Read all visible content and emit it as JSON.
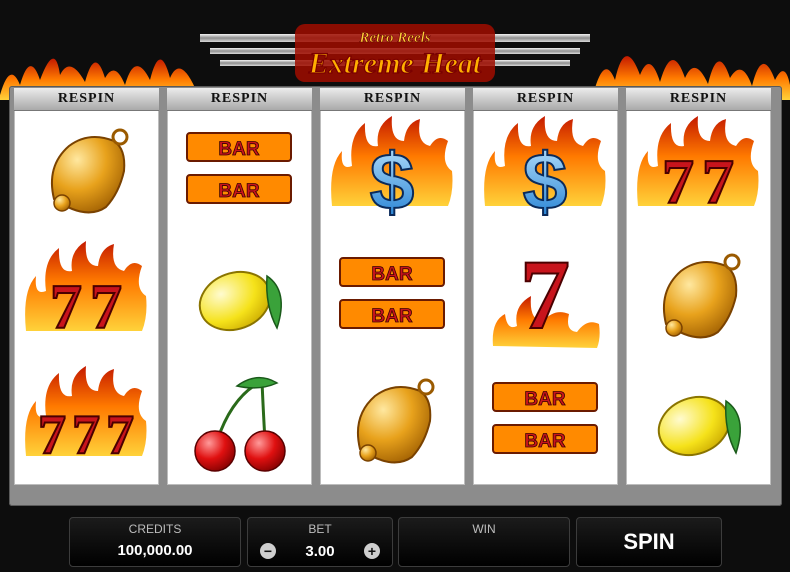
{
  "logo": {
    "line1": "Retro Reels",
    "line2": "Extreme Heat"
  },
  "reels": [
    {
      "header": "RESPIN",
      "symbols": [
        "bell",
        "double-seven",
        "triple-seven"
      ]
    },
    {
      "header": "RESPIN",
      "symbols": [
        "double-bar",
        "lemon",
        "cherry"
      ]
    },
    {
      "header": "RESPIN",
      "symbols": [
        "dollar",
        "double-bar",
        "bell"
      ]
    },
    {
      "header": "RESPIN",
      "symbols": [
        "dollar",
        "single-seven",
        "double-bar"
      ]
    },
    {
      "header": "RESPIN",
      "symbols": [
        "double-seven",
        "bell",
        "lemon"
      ]
    }
  ],
  "symbol_text": {
    "bar": "BAR",
    "dollar": "$"
  },
  "credits": {
    "label": "CREDITS",
    "value": "100,000.00"
  },
  "bet": {
    "label": "BET",
    "value": "3.00",
    "minus": "−",
    "plus": "+"
  },
  "win": {
    "label": "WIN",
    "value": ""
  },
  "spin": {
    "label": "SPIN"
  },
  "colors": {
    "cabinet": "#8c8c8c",
    "reel_bg": "#ffffff",
    "flame": "#ff7a00",
    "seven_red": "#c8141c",
    "gold": "#e8a21c"
  }
}
